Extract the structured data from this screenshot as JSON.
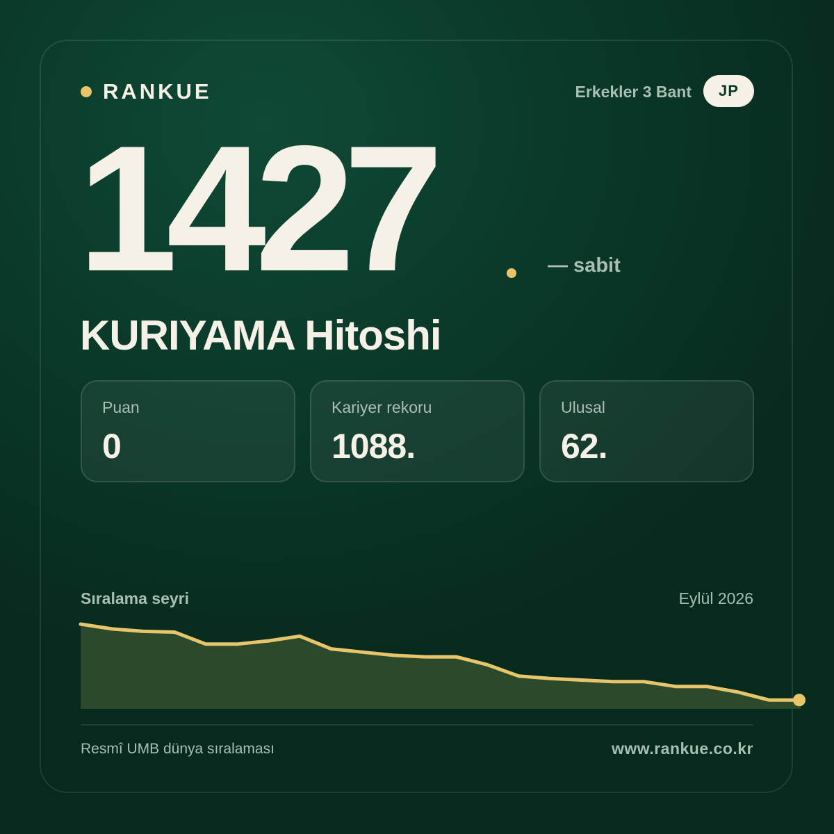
{
  "brand": {
    "name": "RANKUE",
    "accent_color": "#e8c56a"
  },
  "header": {
    "category": "Erkekler 3 Bant",
    "country": "JP"
  },
  "player": {
    "rank": "1427",
    "rank_change": "— sabit",
    "name": "KURIYAMA Hitoshi"
  },
  "stats": [
    {
      "label": "Puan",
      "value": "0"
    },
    {
      "label": "Kariyer rekoru",
      "value": "1088."
    },
    {
      "label": "Ulusal",
      "value": "62."
    }
  ],
  "trend": {
    "title": "Sıralama seyri",
    "date": "Eylül 2026",
    "line_color": "#e8c56a",
    "fill_color": "#2b4a2c"
  },
  "chart_data": {
    "type": "area",
    "title": "Sıralama seyri",
    "xlabel": "",
    "ylabel": "",
    "grid": false,
    "inverted_rank_axis": true,
    "values": [
      0,
      6,
      9,
      10,
      25,
      25,
      21,
      15,
      31,
      35,
      39,
      41,
      41,
      51,
      65,
      68,
      70,
      72,
      72,
      78,
      78,
      85,
      95,
      95
    ]
  },
  "footer": {
    "source": "Resmî UMB dünya sıralaması",
    "website": "www.rankue.co.kr"
  }
}
